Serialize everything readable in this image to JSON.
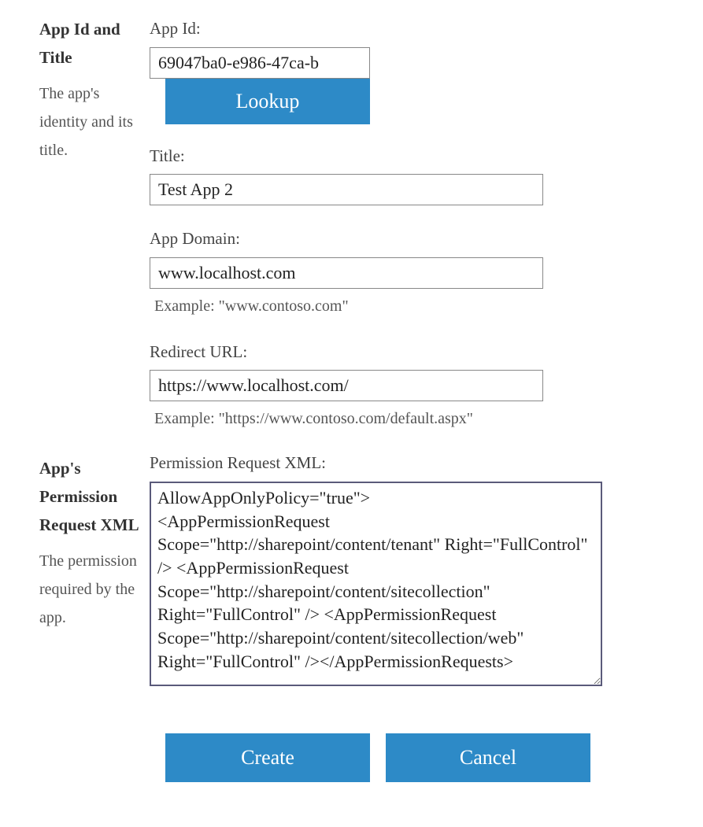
{
  "section1": {
    "title": "App Id and Title",
    "desc": "The app's identity and its title.",
    "appIdLabel": "App Id:",
    "appIdValue": "69047ba0-e986-47ca-b",
    "lookupLabel": "Lookup",
    "titleLabel": "Title:",
    "titleValue": "Test App 2",
    "appDomainLabel": "App Domain:",
    "appDomainValue": "www.localhost.com",
    "appDomainHint": "Example: \"www.contoso.com\"",
    "redirectLabel": "Redirect URL:",
    "redirectValue": "https://www.localhost.com/",
    "redirectHint": "Example: \"https://www.contoso.com/default.aspx\""
  },
  "section2": {
    "title": "App's Permission Request XML",
    "desc": "The permission required by the app.",
    "xmlLabel": "Permission Request XML:",
    "xmlValue": "AllowAppOnlyPolicy=\"true\">\n<AppPermissionRequest Scope=\"http://sharepoint/content/tenant\" Right=\"FullControl\" /> <AppPermissionRequest Scope=\"http://sharepoint/content/sitecollection\" Right=\"FullControl\" /> <AppPermissionRequest Scope=\"http://sharepoint/content/sitecollection/web\" Right=\"FullControl\" /></AppPermissionRequests>"
  },
  "buttons": {
    "createLabel": "Create",
    "cancelLabel": "Cancel"
  }
}
